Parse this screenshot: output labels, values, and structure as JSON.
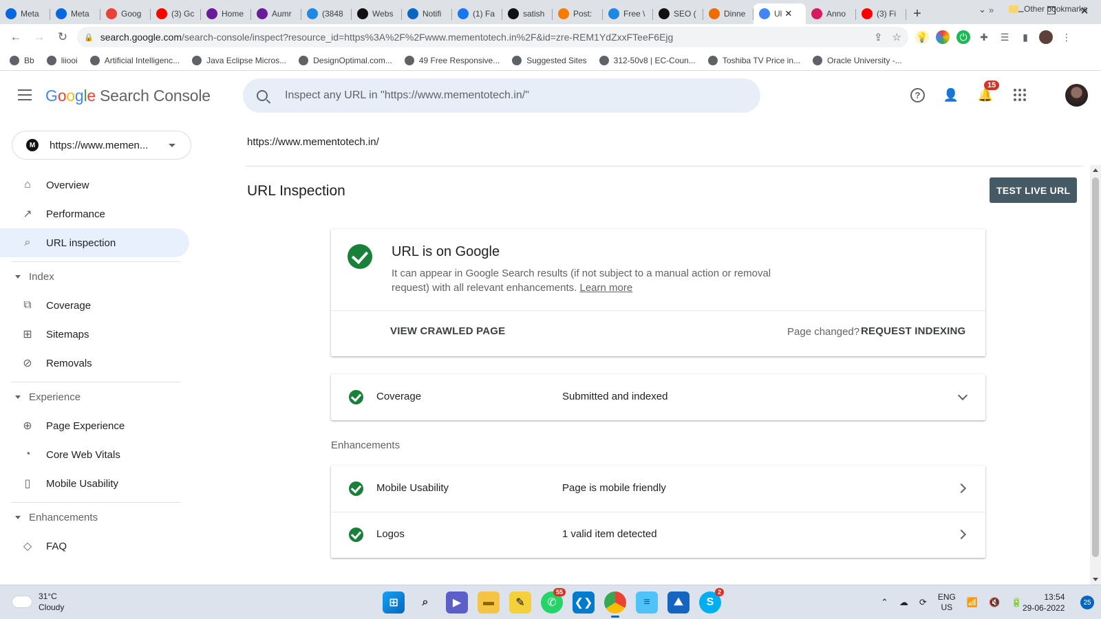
{
  "browser": {
    "tabs": [
      {
        "label": "Meta",
        "icon": "meta-icon",
        "color": "#0668e1"
      },
      {
        "label": "Meta",
        "icon": "meta-icon",
        "color": "#0668e1"
      },
      {
        "label": "Goog",
        "icon": "gmail-icon",
        "color": "#ea4335"
      },
      {
        "label": "(3) Gc",
        "icon": "youtube-icon",
        "color": "#ff0000"
      },
      {
        "label": "Home",
        "icon": "circle-icon",
        "color": "#6a1b9a"
      },
      {
        "label": "Aumr",
        "icon": "circle-icon",
        "color": "#6a1b9a"
      },
      {
        "label": "(3848",
        "icon": "wave-icon",
        "color": "#1e88e5"
      },
      {
        "label": "Webs",
        "icon": "m-icon",
        "color": "#111111"
      },
      {
        "label": "Notifi",
        "icon": "linkedin-icon",
        "color": "#0a66c2"
      },
      {
        "label": "(1) Fa",
        "icon": "facebook-icon",
        "color": "#1877f2"
      },
      {
        "label": "satish",
        "icon": "m-icon",
        "color": "#111111"
      },
      {
        "label": "Post:",
        "icon": "blogger-icon",
        "color": "#f57c00"
      },
      {
        "label": "Free \\",
        "icon": "bird-icon",
        "color": "#1e88e5"
      },
      {
        "label": "SEO (",
        "icon": "m-icon",
        "color": "#111111"
      },
      {
        "label": "Dinne",
        "icon": "arrow-icon",
        "color": "#ef6c00"
      },
      {
        "label": "Ul",
        "icon": "gsc-icon",
        "color": "#4285f4",
        "active": true
      },
      {
        "label": "Anno",
        "icon": "circle-icon",
        "color": "#d81b60"
      },
      {
        "label": "(3) Fi",
        "icon": "youtube-icon",
        "color": "#ff0000"
      }
    ],
    "close_glyph": "✕",
    "new_tab_glyph": "+",
    "window_controls": [
      "—",
      "❐",
      "✕"
    ],
    "url_host": "search.google.com",
    "url_path": "/search-console/inspect?resource_id=https%3A%2F%2Fwww.mementotech.in%2F&id=zre-REM1YdZxxFTeeF6Ejg",
    "bookmarks": [
      {
        "label": "Bb",
        "icon": "globe-icon"
      },
      {
        "label": "liiooi",
        "icon": "globe-icon"
      },
      {
        "label": "Artificial Intelligenc...",
        "icon": "pin-icon"
      },
      {
        "label": "Java Eclipse Micros...",
        "icon": "eclipse-icon"
      },
      {
        "label": "DesignOptimal.com...",
        "icon": "globe-icon"
      },
      {
        "label": "49 Free Responsive...",
        "icon": "flash-icon"
      },
      {
        "label": "Suggested Sites",
        "icon": "bing-icon"
      },
      {
        "label": "312-50v8 | EC-Coun...",
        "icon": "aio-icon"
      },
      {
        "label": "Toshiba TV Price in...",
        "icon": "pdi-icon"
      },
      {
        "label": "Oracle University -...",
        "icon": "oracle-icon"
      }
    ],
    "bookmarks_more": "»",
    "other_bookmarks": "Other bookmarks"
  },
  "header": {
    "logo_g": [
      "G",
      "o",
      "o",
      "g",
      "l",
      "e"
    ],
    "logo_product": "Search Console",
    "search_placeholder": "Inspect any URL in \"https://www.mementotech.in/\"",
    "notification_count": "15"
  },
  "sidebar": {
    "property": "https://www.memen...",
    "items": [
      {
        "label": "Overview",
        "icon": "home-icon"
      },
      {
        "label": "Performance",
        "icon": "trending-up-icon"
      },
      {
        "label": "URL inspection",
        "icon": "search-icon",
        "active": true
      }
    ],
    "sections": [
      {
        "title": "Index",
        "items": [
          {
            "label": "Coverage",
            "icon": "file-copy-icon"
          },
          {
            "label": "Sitemaps",
            "icon": "sitemap-icon"
          },
          {
            "label": "Removals",
            "icon": "eye-off-icon"
          }
        ]
      },
      {
        "title": "Experience",
        "items": [
          {
            "label": "Page Experience",
            "icon": "plus-circle-icon"
          },
          {
            "label": "Core Web Vitals",
            "icon": "speed-icon"
          },
          {
            "label": "Mobile Usability",
            "icon": "phone-icon"
          }
        ]
      },
      {
        "title": "Enhancements",
        "items": [
          {
            "label": "FAQ",
            "icon": "layers-icon"
          }
        ]
      }
    ]
  },
  "main": {
    "inspected_url": "https://www.mementotech.in/",
    "title": "URL Inspection",
    "test_live_url": "TEST LIVE URL",
    "status": {
      "title": "URL is on Google",
      "description": "It can appear in Google Search results (if not subject to a manual action or removal request) with all relevant enhancements.",
      "learn_more": "Learn more",
      "view_crawled": "VIEW CRAWLED PAGE",
      "page_changed": "Page changed?",
      "request_indexing": "REQUEST INDEXING"
    },
    "coverage": {
      "label": "Coverage",
      "value": "Submitted and indexed"
    },
    "enhancements_label": "Enhancements",
    "enhancements": [
      {
        "label": "Mobile Usability",
        "value": "Page is mobile friendly"
      },
      {
        "label": "Logos",
        "value": "1 valid item detected"
      }
    ]
  },
  "taskbar": {
    "temperature": "31°C",
    "condition": "Cloudy",
    "whatsapp_badge": "55",
    "skype_badge": "2",
    "lang1": "ENG",
    "lang2": "US",
    "time": "13:54",
    "date": "29-06-2022",
    "notification_count": "25"
  },
  "colors": {
    "accent": "#1a73e8",
    "success": "#188038",
    "button_dark": "#455a64",
    "active_nav": "#e8f0fe"
  }
}
